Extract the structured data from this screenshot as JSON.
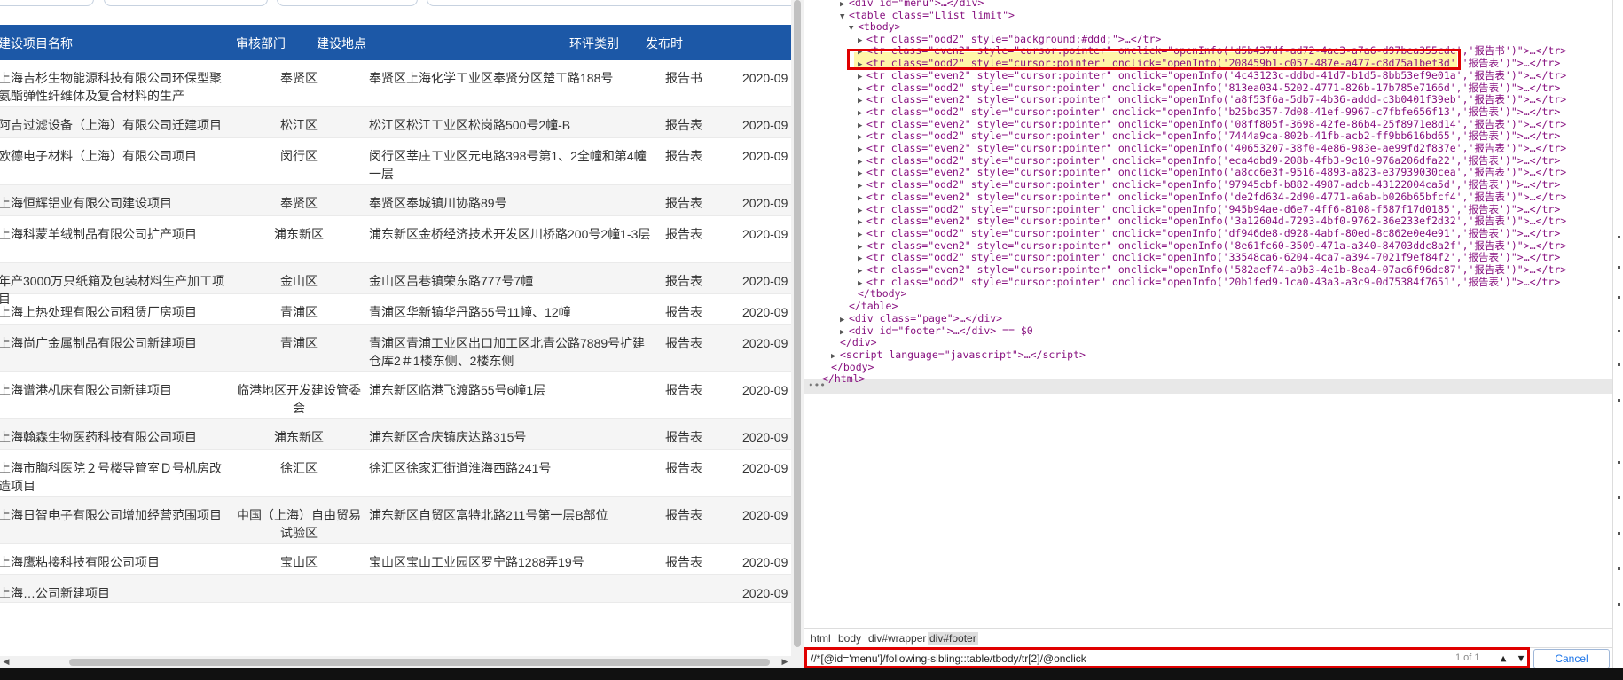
{
  "table": {
    "headers": {
      "name": "建设项目名称",
      "dept": "审核部门",
      "location": "建设地点",
      "type": "环评类别",
      "date": "发布时"
    },
    "rows": [
      {
        "name": "上海吉杉生物能源科技有限公司环保型聚氨酯弹性纤维体及复合材料的生产",
        "dept": "奉贤区",
        "location": "奉贤区上海化学工业区奉贤分区楚工路188号",
        "type": "报告书",
        "date": "2020-09"
      },
      {
        "name": "阿吉过滤设备（上海）有限公司迁建项目",
        "dept": "松江区",
        "location": "松江区松江工业区松岗路500号2幢-B",
        "type": "报告表",
        "date": "2020-09"
      },
      {
        "name": "欧德电子材料（上海）有限公司项目",
        "dept": "闵行区",
        "location": "闵行区莘庄工业区元电路398号第1、2全幢和第4幢一层",
        "type": "报告表",
        "date": "2020-09"
      },
      {
        "name": "上海恒辉铝业有限公司建设项目",
        "dept": "奉贤区",
        "location": "奉贤区奉城镇川协路89号",
        "type": "报告表",
        "date": "2020-09"
      },
      {
        "name": "上海科蒙羊绒制品有限公司扩产项目",
        "dept": "浦东新区",
        "location": "浦东新区金桥经济技术开发区川桥路200号2幢1-3层",
        "type": "报告表",
        "date": "2020-09"
      },
      {
        "name": "年产3000万只纸箱及包装材料生产加工项目",
        "dept": "金山区",
        "location": "金山区吕巷镇荣东路777号7幢",
        "type": "报告表",
        "date": "2020-09"
      },
      {
        "name": "上海上热处理有限公司租赁厂房项目",
        "dept": "青浦区",
        "location": "青浦区华新镇华丹路55号11幢、12幢",
        "type": "报告表",
        "date": "2020-09"
      },
      {
        "name": "上海尚广金属制品有限公司新建项目",
        "dept": "青浦区",
        "location": "青浦区青浦工业区出口加工区北青公路7889号扩建仓库2＃1楼东侧、2楼东侧",
        "type": "报告表",
        "date": "2020-09"
      },
      {
        "name": "上海谱港机床有限公司新建项目",
        "dept": "临港地区开发建设管委会",
        "location": "浦东新区临港飞渡路55号6幢1层",
        "type": "报告表",
        "date": "2020-09"
      },
      {
        "name": "上海翰森生物医药科技有限公司项目",
        "dept": "浦东新区",
        "location": "浦东新区合庆镇庆达路315号",
        "type": "报告表",
        "date": "2020-09"
      },
      {
        "name": "上海市胸科医院２号楼导管室Ｄ号机房改造项目",
        "dept": "徐汇区",
        "location": "徐汇区徐家汇街道淮海西路241号",
        "type": "报告表",
        "date": "2020-09"
      },
      {
        "name": "上海日智电子有限公司增加经营范围项目",
        "dept": "中国（上海）自由贸易试验区",
        "location": "浦东新区自贸区富特北路211号第一层B部位",
        "type": "报告表",
        "date": "2020-09"
      },
      {
        "name": "上海鹰粘接科技有限公司项目",
        "dept": "宝山区",
        "location": "宝山区宝山工业园区罗宁路1288弄19号",
        "type": "报告表",
        "date": "2020-09"
      },
      {
        "name": "上海…公司新建项目",
        "dept": "",
        "location": "",
        "type": "",
        "date": "2020-09"
      }
    ]
  },
  "devtools": {
    "lines": [
      {
        "indent": 3,
        "tri": "▶",
        "html": "&lt;div id=\"menu\"&gt;…&lt;/div&gt;"
      },
      {
        "indent": 3,
        "tri": "▼",
        "html": "&lt;table class=\"Llist limit\"&gt;"
      },
      {
        "indent": 4,
        "tri": "▼",
        "html": "&lt;tbody&gt;"
      },
      {
        "indent": 5,
        "tri": "▶",
        "html": "&lt;tr class=\"odd2\" style=\"background:#ddd;\"&gt;…&lt;/tr&gt;"
      },
      {
        "indent": 5,
        "tri": "▶",
        "html": "&lt;tr class=\"even2\" style=\"cursor:pointer\" onclick=\"openInfo('d5b437df-ad72-4ae3-a7a6-d97bea355cdc','报告书')\"&gt;…&lt;/tr&gt;",
        "selected": true
      },
      {
        "indent": 5,
        "tri": "▶",
        "html": "&lt;tr class=\"odd2\" style=\"cursor:pointer\" onclick=\"openInfo('208459b1-c057-487e-a477-c8d75a1bef3d','报告表')\"&gt;…&lt;/tr&gt;"
      },
      {
        "indent": 5,
        "tri": "▶",
        "html": "&lt;tr class=\"even2\" style=\"cursor:pointer\" onclick=\"openInfo('4c43123c-ddbd-41d7-b1d5-8bb53ef9e01a','报告表')\"&gt;…&lt;/tr&gt;"
      },
      {
        "indent": 5,
        "tri": "▶",
        "html": "&lt;tr class=\"odd2\" style=\"cursor:pointer\" onclick=\"openInfo('813ea034-5202-4771-826b-17b785e7166d','报告表')\"&gt;…&lt;/tr&gt;"
      },
      {
        "indent": 5,
        "tri": "▶",
        "html": "&lt;tr class=\"even2\" style=\"cursor:pointer\" onclick=\"openInfo('a8f53f6a-5db7-4b36-addd-c3b0401f39eb','报告表')\"&gt;…&lt;/tr&gt;"
      },
      {
        "indent": 5,
        "tri": "▶",
        "html": "&lt;tr class=\"odd2\" style=\"cursor:pointer\" onclick=\"openInfo('b25bd357-7d08-41ef-9967-c7fbfe656f13','报告表')\"&gt;…&lt;/tr&gt;"
      },
      {
        "indent": 5,
        "tri": "▶",
        "html": "&lt;tr class=\"even2\" style=\"cursor:pointer\" onclick=\"openInfo('08ff805f-3698-42fe-86b4-25f8971e8d14','报告表')\"&gt;…&lt;/tr&gt;"
      },
      {
        "indent": 5,
        "tri": "▶",
        "html": "&lt;tr class=\"odd2\" style=\"cursor:pointer\" onclick=\"openInfo('7444a9ca-802b-41fb-acb2-ff9bb616bd65','报告表')\"&gt;…&lt;/tr&gt;"
      },
      {
        "indent": 5,
        "tri": "▶",
        "html": "&lt;tr class=\"even2\" style=\"cursor:pointer\" onclick=\"openInfo('40653207-38f0-4e86-983e-ae99fd2f837e','报告表')\"&gt;…&lt;/tr&gt;"
      },
      {
        "indent": 5,
        "tri": "▶",
        "html": "&lt;tr class=\"odd2\" style=\"cursor:pointer\" onclick=\"openInfo('eca4dbd9-208b-4fb3-9c10-976a206dfa22','报告表')\"&gt;…&lt;/tr&gt;"
      },
      {
        "indent": 5,
        "tri": "▶",
        "html": "&lt;tr class=\"even2\" style=\"cursor:pointer\" onclick=\"openInfo('a8cc6e3f-9516-4893-a823-e37939030cea','报告表')\"&gt;…&lt;/tr&gt;"
      },
      {
        "indent": 5,
        "tri": "▶",
        "html": "&lt;tr class=\"odd2\" style=\"cursor:pointer\" onclick=\"openInfo('97945cbf-b882-4987-adcb-43122004ca5d','报告表')\"&gt;…&lt;/tr&gt;"
      },
      {
        "indent": 5,
        "tri": "▶",
        "html": "&lt;tr class=\"even2\" style=\"cursor:pointer\" onclick=\"openInfo('de2fd634-2d90-4771-a6ab-b026b65bfcf4','报告表')\"&gt;…&lt;/tr&gt;"
      },
      {
        "indent": 5,
        "tri": "▶",
        "html": "&lt;tr class=\"odd2\" style=\"cursor:pointer\" onclick=\"openInfo('945b94ae-d6e7-4ff6-8108-f587f17d0185','报告表')\"&gt;…&lt;/tr&gt;"
      },
      {
        "indent": 5,
        "tri": "▶",
        "html": "&lt;tr class=\"even2\" style=\"cursor:pointer\" onclick=\"openInfo('3a12604d-7293-4bf0-9762-36e233ef2d32','报告表')\"&gt;…&lt;/tr&gt;"
      },
      {
        "indent": 5,
        "tri": "▶",
        "html": "&lt;tr class=\"odd2\" style=\"cursor:pointer\" onclick=\"openInfo('df946de8-d928-4abf-80ed-8c862e0e4e91','报告表')\"&gt;…&lt;/tr&gt;"
      },
      {
        "indent": 5,
        "tri": "▶",
        "html": "&lt;tr class=\"even2\" style=\"cursor:pointer\" onclick=\"openInfo('8e61fc60-3509-471a-a340-84703ddc8a2f','报告表')\"&gt;…&lt;/tr&gt;"
      },
      {
        "indent": 5,
        "tri": "▶",
        "html": "&lt;tr class=\"odd2\" style=\"cursor:pointer\" onclick=\"openInfo('33548ca6-6204-4ca7-a394-7021f9ef84f2','报告表')\"&gt;…&lt;/tr&gt;"
      },
      {
        "indent": 5,
        "tri": "▶",
        "html": "&lt;tr class=\"even2\" style=\"cursor:pointer\" onclick=\"openInfo('582aef74-a9b3-4e1b-8ea4-07ac6f96dc87','报告表')\"&gt;…&lt;/tr&gt;"
      },
      {
        "indent": 5,
        "tri": "▶",
        "html": "&lt;tr class=\"odd2\" style=\"cursor:pointer\" onclick=\"openInfo('20b1fed9-1ca0-43a3-a3c9-0d75384f7651','报告表')\"&gt;…&lt;/tr&gt;"
      },
      {
        "indent": 4,
        "tri": "",
        "html": "&lt;/tbody&gt;"
      },
      {
        "indent": 3,
        "tri": "",
        "html": "&lt;/table&gt;"
      },
      {
        "indent": 3,
        "tri": "▶",
        "html": "&lt;div class=\"page\"&gt;…&lt;/div&gt;"
      },
      {
        "indent": 3,
        "tri": "▶",
        "html": "&lt;div id=\"footer\"&gt;…&lt;/div&gt; == $0",
        "footer": true
      },
      {
        "indent": 2,
        "tri": "",
        "html": "&lt;/div&gt;"
      },
      {
        "indent": 2,
        "tri": "▶",
        "html": "&lt;script language=\"javascript\"&gt;…&lt;/script&gt;"
      },
      {
        "indent": 1,
        "tri": "",
        "html": "&lt;/body&gt;"
      },
      {
        "indent": 0,
        "tri": "",
        "html": "&lt;/html&gt;"
      }
    ],
    "breadcrumb": [
      "html",
      "body",
      "div#wrapper",
      "div#footer"
    ],
    "xpath": "//*[@id='menu']/following-sibling::table/tbody/tr[2]/@onclick",
    "match_count": "1 of 1",
    "cancel_label": "Cancel"
  },
  "colors": {
    "header_bg": "#1c58a7",
    "highlight_box": "#e00000"
  }
}
